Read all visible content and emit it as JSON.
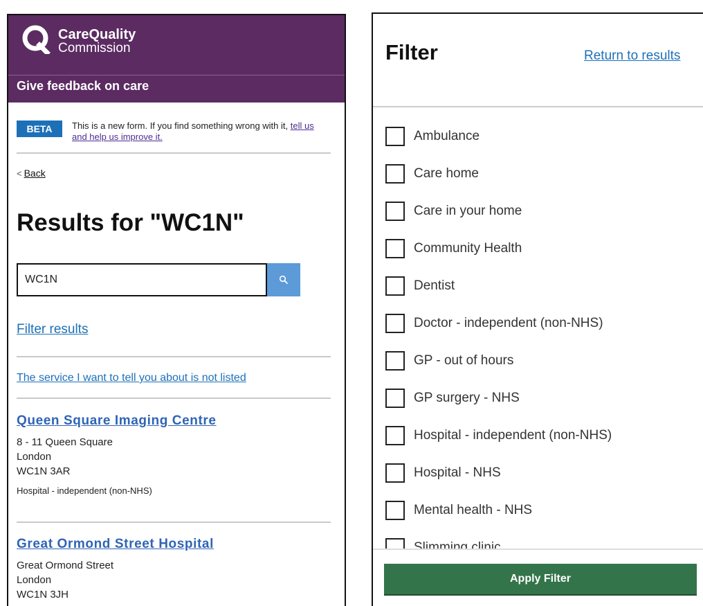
{
  "header": {
    "logo_line1": "CareQuality",
    "logo_line2": "Commission",
    "service_name": "Give feedback on care",
    "brand_color": "#5c2b62"
  },
  "beta_banner": {
    "tag": "BETA",
    "text": "This is a new form. If you find something wrong with it,",
    "link": "tell us and help us improve it."
  },
  "nav": {
    "back_label": "Back"
  },
  "results": {
    "title": "Results for \"WC1N\"",
    "search_value": "WC1N",
    "filter_link": "Filter results",
    "not_listed_link": "The service I want to tell you about is not listed",
    "items": [
      {
        "name": "Queen Square Imaging Centre",
        "address": [
          "8 - 11 Queen Square",
          "London",
          "WC1N 3AR"
        ],
        "type": "Hospital - independent (non-NHS)"
      },
      {
        "name": "Great Ormond Street Hospital",
        "address": [
          "Great Ormond Street",
          "London",
          "WC1N 3JH"
        ]
      }
    ]
  },
  "filter_panel": {
    "title": "Filter",
    "return_link": "Return to results",
    "options": [
      "Ambulance",
      "Care home",
      "Care in your home",
      "Community Health",
      "Dentist",
      "Doctor - independent (non-NHS)",
      "GP - out of hours",
      "GP surgery - NHS",
      "Hospital - independent (non-NHS)",
      "Hospital - NHS",
      "Mental health - NHS",
      "Slimming clinic"
    ],
    "apply_label": "Apply Filter",
    "apply_color": "#34744a"
  }
}
